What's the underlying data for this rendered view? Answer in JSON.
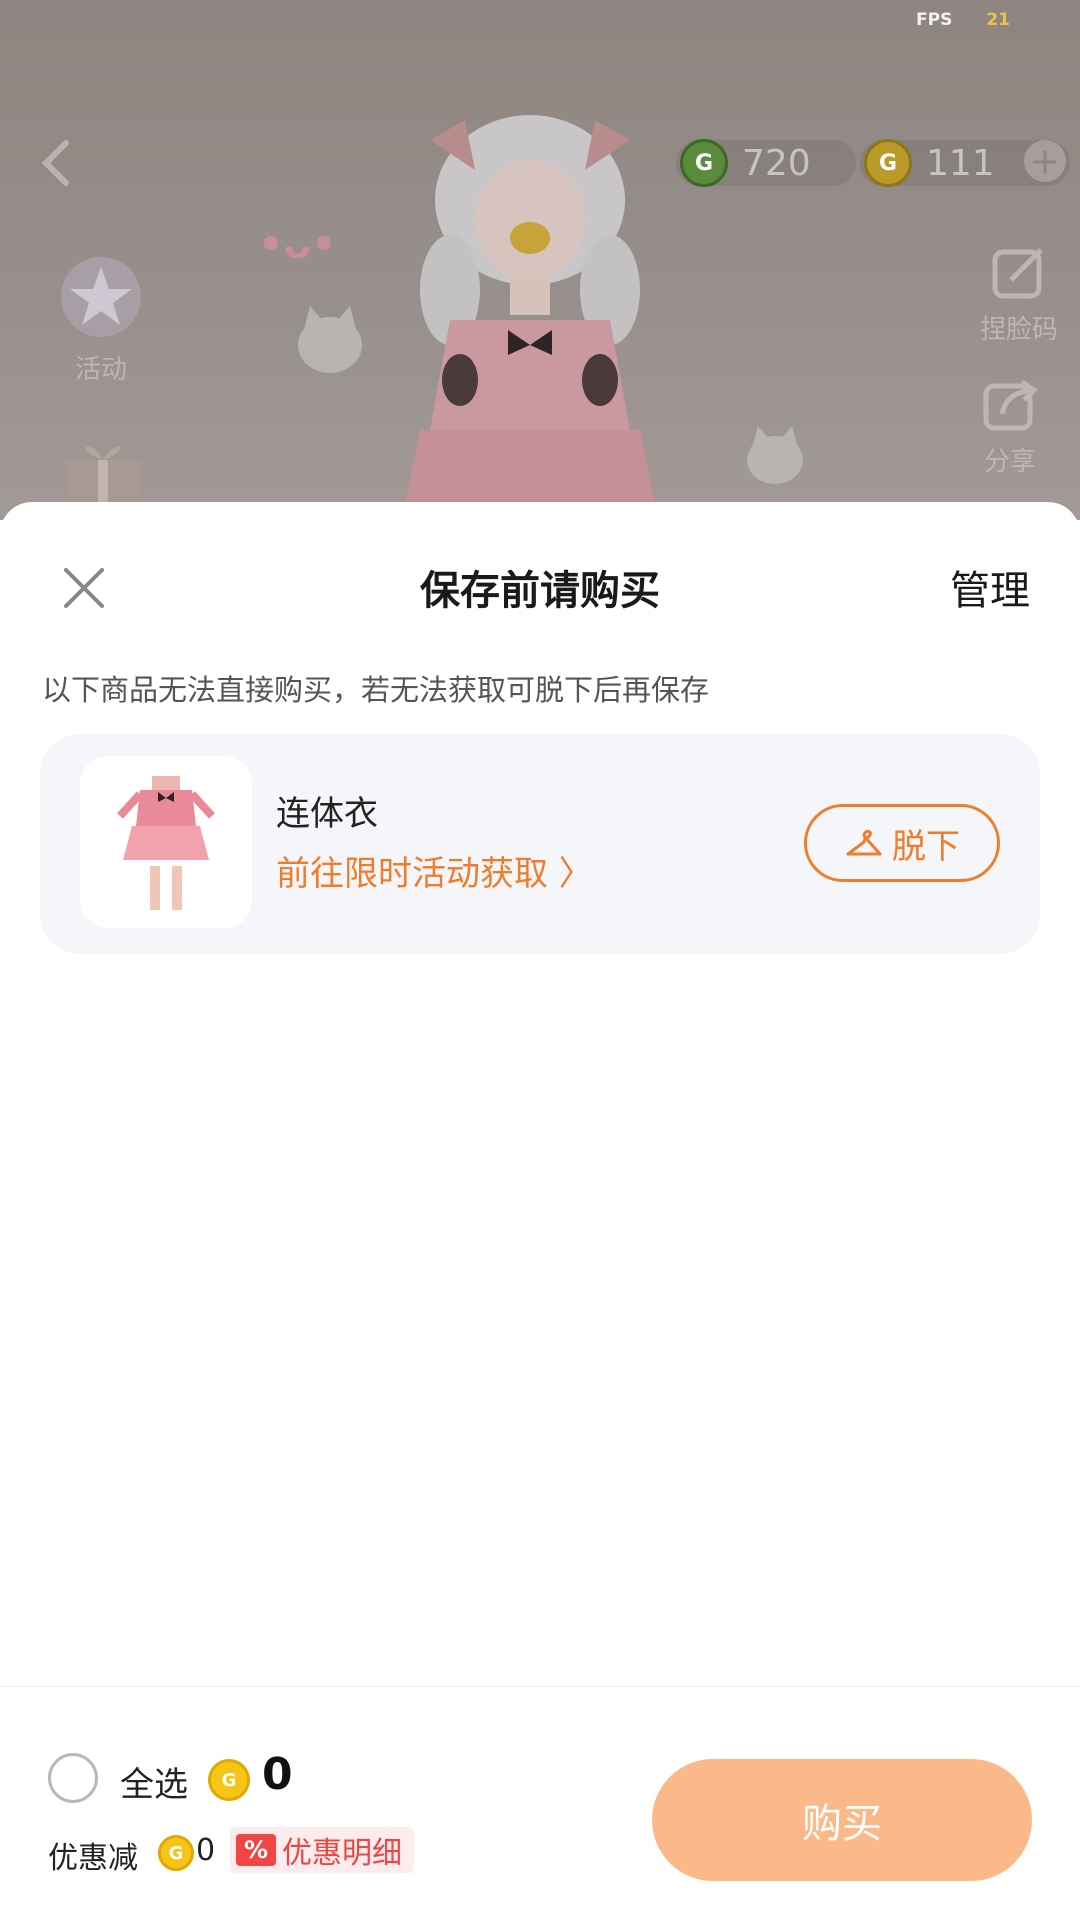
{
  "hud": {
    "fps_label": "FPS",
    "fps_value": "21",
    "currency_green": "720",
    "currency_gold": "111",
    "side_left_1": "活动",
    "side_right_1": "捏脸码",
    "side_right_2": "分享"
  },
  "sheet": {
    "title": "保存前请购买",
    "manage": "管理",
    "notice": "以下商品无法直接购买，若无法获取可脱下后再保存",
    "items": [
      {
        "name": "连体衣",
        "link": "前往限时活动获取 〉",
        "action": "脱下"
      }
    ]
  },
  "footer": {
    "select_all": "全选",
    "total": "0",
    "discount_label": "优惠减",
    "discount_value": "0",
    "pct_icon": "%",
    "detail": "优惠明细",
    "buy": "购买"
  },
  "colors": {
    "accent": "#ef7d2c",
    "buy_button": "#fbb98a",
    "discount_red": "#f04545",
    "card_bg": "#f4f6fa"
  }
}
